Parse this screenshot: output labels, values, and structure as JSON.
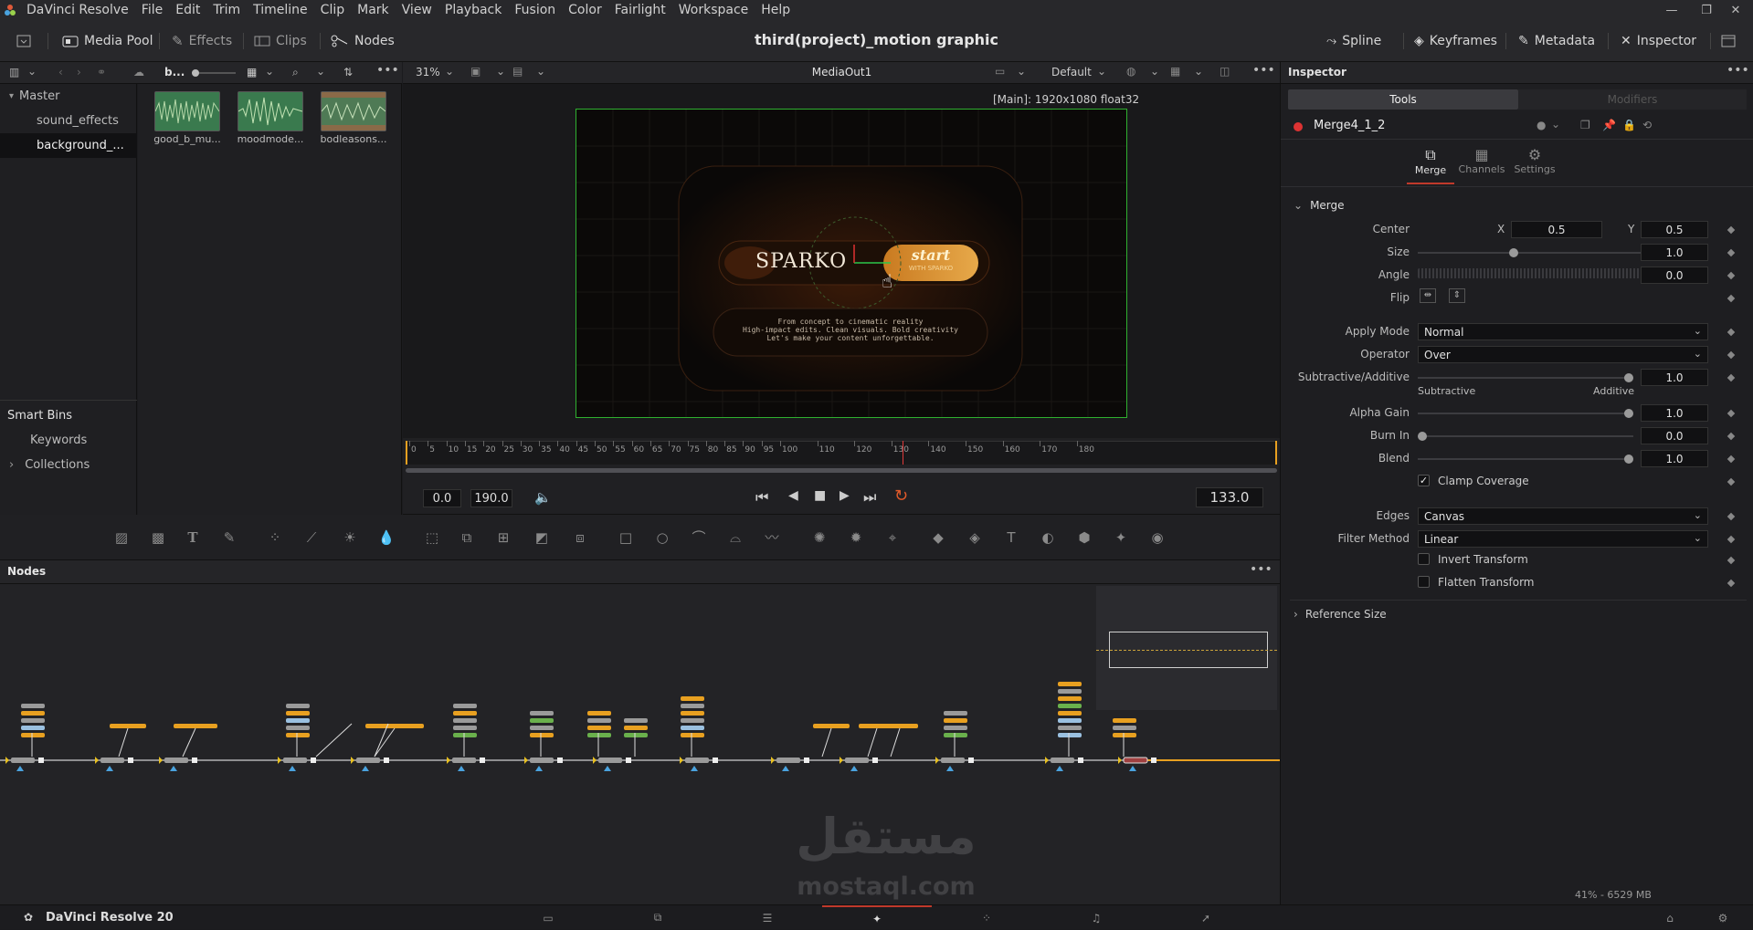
{
  "app": {
    "name": "DaVinci Resolve",
    "version_label": "DaVinci Resolve 20"
  },
  "menu": [
    "File",
    "Edit",
    "Trim",
    "Timeline",
    "Clip",
    "Mark",
    "View",
    "Playback",
    "Fusion",
    "Color",
    "Fairlight",
    "Workspace",
    "Help"
  ],
  "toolbar": {
    "media_pool": "Media Pool",
    "effects": "Effects",
    "clips": "Clips",
    "nodes": "Nodes",
    "project_title": "third(project)_motion graphic",
    "spline": "Spline",
    "keyframes": "Keyframes",
    "metadata": "Metadata",
    "inspector": "Inspector"
  },
  "media_pool": {
    "bin_short": "b...",
    "bins": [
      {
        "label": "Master",
        "indent": 0,
        "selected": false
      },
      {
        "label": "sound_effects",
        "indent": 1,
        "selected": false
      },
      {
        "label": "background_...",
        "indent": 1,
        "selected": true
      }
    ],
    "smart_bins_title": "Smart Bins",
    "smart_bins": [
      "Keywords",
      "Collections"
    ],
    "clips": [
      {
        "label": "good_b_mu...",
        "kind": "audio"
      },
      {
        "label": "moodmode...",
        "kind": "audio"
      },
      {
        "label": "bodleasons...",
        "kind": "audio-video"
      }
    ]
  },
  "viewer": {
    "zoom": "31%",
    "node_name": "MediaOut1",
    "lut": "Default",
    "resolution_info": "[Main]: 1920x1080 float32",
    "content": {
      "brand": "SPARKO",
      "button_title": "start",
      "button_sub": "WITH SPARKO",
      "tagline": [
        "From concept to cinematic reality",
        "High-impact edits. Clean visuals. Bold creativity",
        "Let's make your content unforgettable."
      ]
    }
  },
  "ruler": {
    "ticks": [
      "0",
      "5",
      "10",
      "15",
      "20",
      "25",
      "30",
      "35",
      "40",
      "45",
      "50",
      "55",
      "60",
      "65",
      "70",
      "75",
      "80",
      "85",
      "90",
      "95",
      "100",
      "110",
      "120",
      "130",
      "140",
      "150",
      "160",
      "170",
      "180"
    ],
    "playhead": 133,
    "end": 190
  },
  "transport": {
    "start": "0.0",
    "end": "190.0",
    "current": "133.0"
  },
  "nodes_panel": {
    "title": "Nodes"
  },
  "inspector": {
    "title": "Inspector",
    "tabs": [
      "Tools",
      "Modifiers"
    ],
    "node_name": "Merge4_1_2",
    "subtabs": [
      "Merge",
      "Channels",
      "Settings"
    ],
    "section": "Merge",
    "center": {
      "label": "Center",
      "x_label": "X",
      "x": "0.5",
      "y_label": "Y",
      "y": "0.5"
    },
    "size": {
      "label": "Size",
      "value": "1.0"
    },
    "angle": {
      "label": "Angle",
      "value": "0.0"
    },
    "flip": {
      "label": "Flip"
    },
    "apply_mode": {
      "label": "Apply Mode",
      "value": "Normal"
    },
    "operator": {
      "label": "Operator",
      "value": "Over"
    },
    "sub_add": {
      "label": "Subtractive/Additive",
      "value": "1.0",
      "left": "Subtractive",
      "right": "Additive"
    },
    "alpha_gain": {
      "label": "Alpha Gain",
      "value": "1.0"
    },
    "burn_in": {
      "label": "Burn In",
      "value": "0.0"
    },
    "blend": {
      "label": "Blend",
      "value": "1.0"
    },
    "clamp": {
      "label": "Clamp Coverage",
      "checked": true
    },
    "edges": {
      "label": "Edges",
      "value": "Canvas"
    },
    "filter": {
      "label": "Filter Method",
      "value": "Linear"
    },
    "invert": {
      "label": "Invert Transform",
      "checked": false
    },
    "flatten": {
      "label": "Flatten Transform",
      "checked": false
    },
    "reference": "Reference Size"
  },
  "status": {
    "memory": "41% - 6529 MB"
  },
  "watermark": {
    "arabic": "مستقل",
    "latin": "mostaql.com"
  },
  "colors": {
    "accent": "#e8a020",
    "viewer_border": "#2fb02f",
    "active_tab": "#c0392b"
  }
}
